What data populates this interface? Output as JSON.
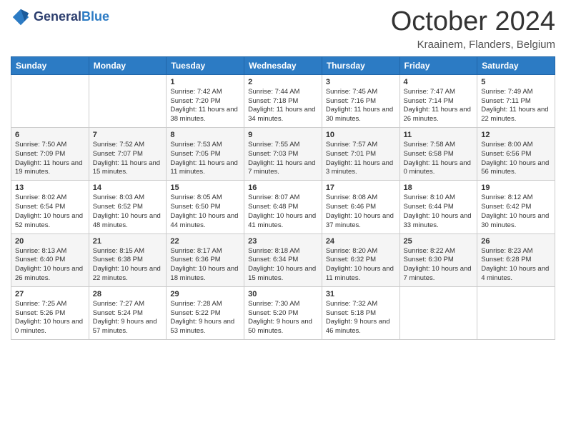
{
  "header": {
    "logo_line1": "General",
    "logo_line2": "Blue",
    "month": "October 2024",
    "location": "Kraainem, Flanders, Belgium"
  },
  "weekdays": [
    "Sunday",
    "Monday",
    "Tuesday",
    "Wednesday",
    "Thursday",
    "Friday",
    "Saturday"
  ],
  "weeks": [
    [
      {
        "day": "",
        "info": ""
      },
      {
        "day": "",
        "info": ""
      },
      {
        "day": "1",
        "info": "Sunrise: 7:42 AM\nSunset: 7:20 PM\nDaylight: 11 hours and 38 minutes."
      },
      {
        "day": "2",
        "info": "Sunrise: 7:44 AM\nSunset: 7:18 PM\nDaylight: 11 hours and 34 minutes."
      },
      {
        "day": "3",
        "info": "Sunrise: 7:45 AM\nSunset: 7:16 PM\nDaylight: 11 hours and 30 minutes."
      },
      {
        "day": "4",
        "info": "Sunrise: 7:47 AM\nSunset: 7:14 PM\nDaylight: 11 hours and 26 minutes."
      },
      {
        "day": "5",
        "info": "Sunrise: 7:49 AM\nSunset: 7:11 PM\nDaylight: 11 hours and 22 minutes."
      }
    ],
    [
      {
        "day": "6",
        "info": "Sunrise: 7:50 AM\nSunset: 7:09 PM\nDaylight: 11 hours and 19 minutes."
      },
      {
        "day": "7",
        "info": "Sunrise: 7:52 AM\nSunset: 7:07 PM\nDaylight: 11 hours and 15 minutes."
      },
      {
        "day": "8",
        "info": "Sunrise: 7:53 AM\nSunset: 7:05 PM\nDaylight: 11 hours and 11 minutes."
      },
      {
        "day": "9",
        "info": "Sunrise: 7:55 AM\nSunset: 7:03 PM\nDaylight: 11 hours and 7 minutes."
      },
      {
        "day": "10",
        "info": "Sunrise: 7:57 AM\nSunset: 7:01 PM\nDaylight: 11 hours and 3 minutes."
      },
      {
        "day": "11",
        "info": "Sunrise: 7:58 AM\nSunset: 6:58 PM\nDaylight: 11 hours and 0 minutes."
      },
      {
        "day": "12",
        "info": "Sunrise: 8:00 AM\nSunset: 6:56 PM\nDaylight: 10 hours and 56 minutes."
      }
    ],
    [
      {
        "day": "13",
        "info": "Sunrise: 8:02 AM\nSunset: 6:54 PM\nDaylight: 10 hours and 52 minutes."
      },
      {
        "day": "14",
        "info": "Sunrise: 8:03 AM\nSunset: 6:52 PM\nDaylight: 10 hours and 48 minutes."
      },
      {
        "day": "15",
        "info": "Sunrise: 8:05 AM\nSunset: 6:50 PM\nDaylight: 10 hours and 44 minutes."
      },
      {
        "day": "16",
        "info": "Sunrise: 8:07 AM\nSunset: 6:48 PM\nDaylight: 10 hours and 41 minutes."
      },
      {
        "day": "17",
        "info": "Sunrise: 8:08 AM\nSunset: 6:46 PM\nDaylight: 10 hours and 37 minutes."
      },
      {
        "day": "18",
        "info": "Sunrise: 8:10 AM\nSunset: 6:44 PM\nDaylight: 10 hours and 33 minutes."
      },
      {
        "day": "19",
        "info": "Sunrise: 8:12 AM\nSunset: 6:42 PM\nDaylight: 10 hours and 30 minutes."
      }
    ],
    [
      {
        "day": "20",
        "info": "Sunrise: 8:13 AM\nSunset: 6:40 PM\nDaylight: 10 hours and 26 minutes."
      },
      {
        "day": "21",
        "info": "Sunrise: 8:15 AM\nSunset: 6:38 PM\nDaylight: 10 hours and 22 minutes."
      },
      {
        "day": "22",
        "info": "Sunrise: 8:17 AM\nSunset: 6:36 PM\nDaylight: 10 hours and 18 minutes."
      },
      {
        "day": "23",
        "info": "Sunrise: 8:18 AM\nSunset: 6:34 PM\nDaylight: 10 hours and 15 minutes."
      },
      {
        "day": "24",
        "info": "Sunrise: 8:20 AM\nSunset: 6:32 PM\nDaylight: 10 hours and 11 minutes."
      },
      {
        "day": "25",
        "info": "Sunrise: 8:22 AM\nSunset: 6:30 PM\nDaylight: 10 hours and 7 minutes."
      },
      {
        "day": "26",
        "info": "Sunrise: 8:23 AM\nSunset: 6:28 PM\nDaylight: 10 hours and 4 minutes."
      }
    ],
    [
      {
        "day": "27",
        "info": "Sunrise: 7:25 AM\nSunset: 5:26 PM\nDaylight: 10 hours and 0 minutes."
      },
      {
        "day": "28",
        "info": "Sunrise: 7:27 AM\nSunset: 5:24 PM\nDaylight: 9 hours and 57 minutes."
      },
      {
        "day": "29",
        "info": "Sunrise: 7:28 AM\nSunset: 5:22 PM\nDaylight: 9 hours and 53 minutes."
      },
      {
        "day": "30",
        "info": "Sunrise: 7:30 AM\nSunset: 5:20 PM\nDaylight: 9 hours and 50 minutes."
      },
      {
        "day": "31",
        "info": "Sunrise: 7:32 AM\nSunset: 5:18 PM\nDaylight: 9 hours and 46 minutes."
      },
      {
        "day": "",
        "info": ""
      },
      {
        "day": "",
        "info": ""
      }
    ]
  ]
}
